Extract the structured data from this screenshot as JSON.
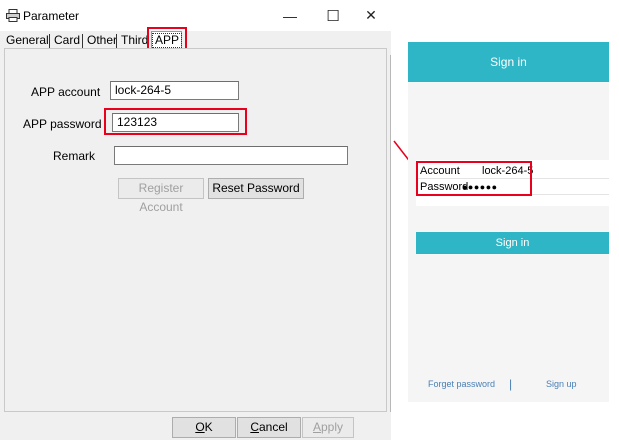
{
  "window": {
    "title": "Parameter",
    "minimize_glyph": "—",
    "maximize_glyph": "☐",
    "close_glyph": "✕"
  },
  "tabs": [
    {
      "label": "General"
    },
    {
      "label": "Card"
    },
    {
      "label": "Other"
    },
    {
      "label": "Third"
    },
    {
      "label": "APP",
      "selected": true
    }
  ],
  "form": {
    "app_account_label": "APP account",
    "app_account_value": "lock-264-5",
    "app_password_label": "APP password",
    "app_password_value": "123123",
    "remark_label": "Remark",
    "remark_value": "",
    "register_account_label": "Register Account",
    "reset_password_label": "Reset Password"
  },
  "footer_buttons": {
    "ok_prefix": "",
    "ok_mnemonic": "O",
    "ok_rest": "K",
    "cancel_mnemonic": "C",
    "cancel_rest": "ancel",
    "apply_mnemonic": "A",
    "apply_rest": "pply"
  },
  "phone": {
    "header_title": "Sign in",
    "account_label": "Account",
    "account_value": "lock-264-5",
    "password_label": "Password",
    "password_value": "●●●●●●",
    "signin_button": "Sign in",
    "forget_password": "Forget password",
    "footer_separator": "|",
    "sign_up": "Sign up"
  },
  "colors": {
    "highlight": "#e8001c",
    "phone_accent": "#2fb6c6",
    "link": "#4a7fb5"
  },
  "icons": {
    "title_icon": "printer-icon",
    "arrow": "red-arrow"
  }
}
